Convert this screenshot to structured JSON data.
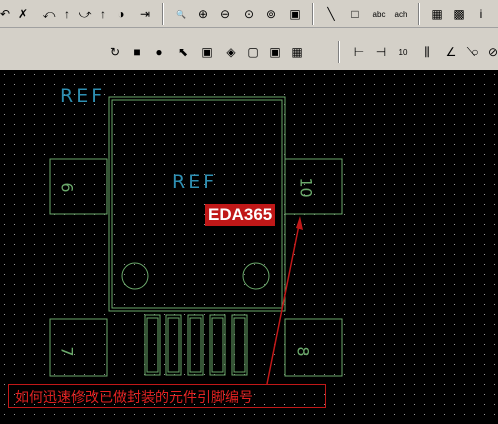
{
  "toolbar_top": {
    "buttons": [
      {
        "name": "undo-icon",
        "glyph": "↶"
      },
      {
        "name": "delete-icon",
        "glyph": "✗"
      },
      {
        "name": "undo-step-icon",
        "glyph": "⤺"
      },
      {
        "name": "move-up-icon",
        "glyph": "↑"
      },
      {
        "name": "redo-step-icon",
        "glyph": "⤻"
      },
      {
        "name": "redo-up-icon",
        "glyph": "↑"
      },
      {
        "name": "properties-icon",
        "glyph": "◑"
      },
      {
        "name": "insert-icon",
        "glyph": "⇥"
      },
      {
        "name": "zoom-icon",
        "glyph": "🔍"
      },
      {
        "name": "zoom-in-icon",
        "glyph": "⊕"
      },
      {
        "name": "zoom-out-icon",
        "glyph": "⊖"
      },
      {
        "name": "zoom-fit-icon",
        "glyph": "⊙"
      },
      {
        "name": "zoom-area-icon",
        "glyph": "⊚"
      },
      {
        "name": "zoom-window-icon",
        "glyph": "▣"
      },
      {
        "name": "draw-line-icon",
        "glyph": "╲"
      },
      {
        "name": "draw-rect-icon",
        "glyph": "□"
      },
      {
        "name": "text-abc-icon",
        "glyph": "abc"
      },
      {
        "name": "text-ach-icon",
        "glyph": "ach"
      },
      {
        "name": "grid-color-icon",
        "glyph": "▦"
      },
      {
        "name": "library-icon",
        "glyph": "▩"
      },
      {
        "name": "info-icon",
        "glyph": "i"
      }
    ]
  },
  "toolbar_bottom": {
    "buttons": [
      {
        "name": "rotate-icon",
        "glyph": "↻"
      },
      {
        "name": "square-pad-icon",
        "glyph": "■"
      },
      {
        "name": "round-pad-icon",
        "glyph": "●"
      },
      {
        "name": "select-arrow-icon",
        "glyph": "⬉"
      },
      {
        "name": "pad-square-alt-icon",
        "glyph": "▣"
      },
      {
        "name": "pad-diamond-icon",
        "glyph": "◈"
      },
      {
        "name": "pad-ring-icon",
        "glyph": "▢"
      },
      {
        "name": "pad-frame-icon",
        "glyph": "▣"
      },
      {
        "name": "pad-grid-icon",
        "glyph": "▦"
      },
      {
        "name": "dim-horizontal-icon",
        "glyph": "⊢"
      },
      {
        "name": "dim-arrow-icon",
        "glyph": "⊣"
      },
      {
        "name": "dim-ten-icon",
        "glyph": "10"
      },
      {
        "name": "dim-multi-icon",
        "glyph": "⫼"
      },
      {
        "name": "angle-icon",
        "glyph": "∠"
      },
      {
        "name": "slope-icon",
        "glyph": "⟍"
      },
      {
        "name": "circle-dim-icon",
        "glyph": "○"
      },
      {
        "name": "radius-icon",
        "glyph": "⊘"
      }
    ]
  },
  "canvas": {
    "ref_outer": "REF",
    "ref_inner": "REF",
    "watermark": "EDA365",
    "caption": "如何迅速修改已做封装的元件引脚编号",
    "pins": [
      {
        "label": "6",
        "name": "pin-6"
      },
      {
        "label": "10",
        "name": "pin-10"
      },
      {
        "label": "7",
        "name": "pin-7"
      },
      {
        "label": "8",
        "name": "pin-8"
      }
    ],
    "colors": {
      "outline": "#6aa86a",
      "ref": "#2e8fb2",
      "annotation": "#c01818"
    }
  }
}
